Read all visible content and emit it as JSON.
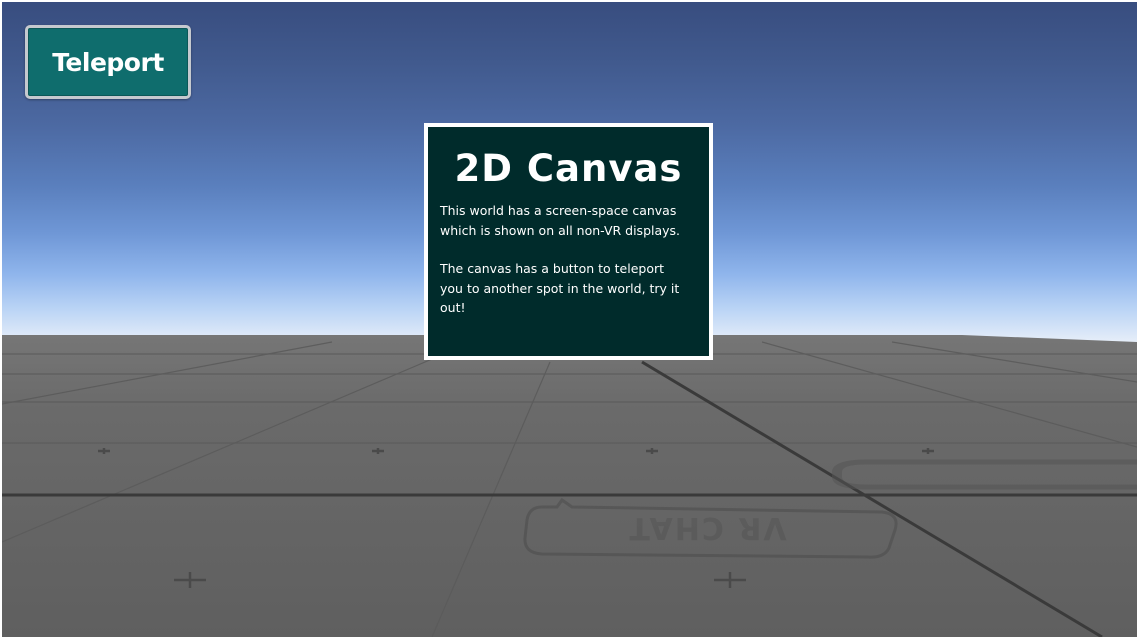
{
  "hud": {
    "teleport_label": "Teleport"
  },
  "panel": {
    "title": "2D Canvas",
    "paragraph_1": "This world has a screen-space canvas\nwhich is shown on all non-VR displays.",
    "paragraph_2": "The canvas has a button to teleport\nyou to another spot in the world, try it\nout!"
  },
  "scene": {
    "floor_logo_text": "VR CHAT",
    "colors": {
      "sky_top": "#384d7f",
      "sky_horizon": "#e6eef9",
      "floor": "#656565",
      "button_fill": "#0f6d6d",
      "panel_fill": "#002b2b",
      "panel_border": "#ffffff"
    }
  }
}
